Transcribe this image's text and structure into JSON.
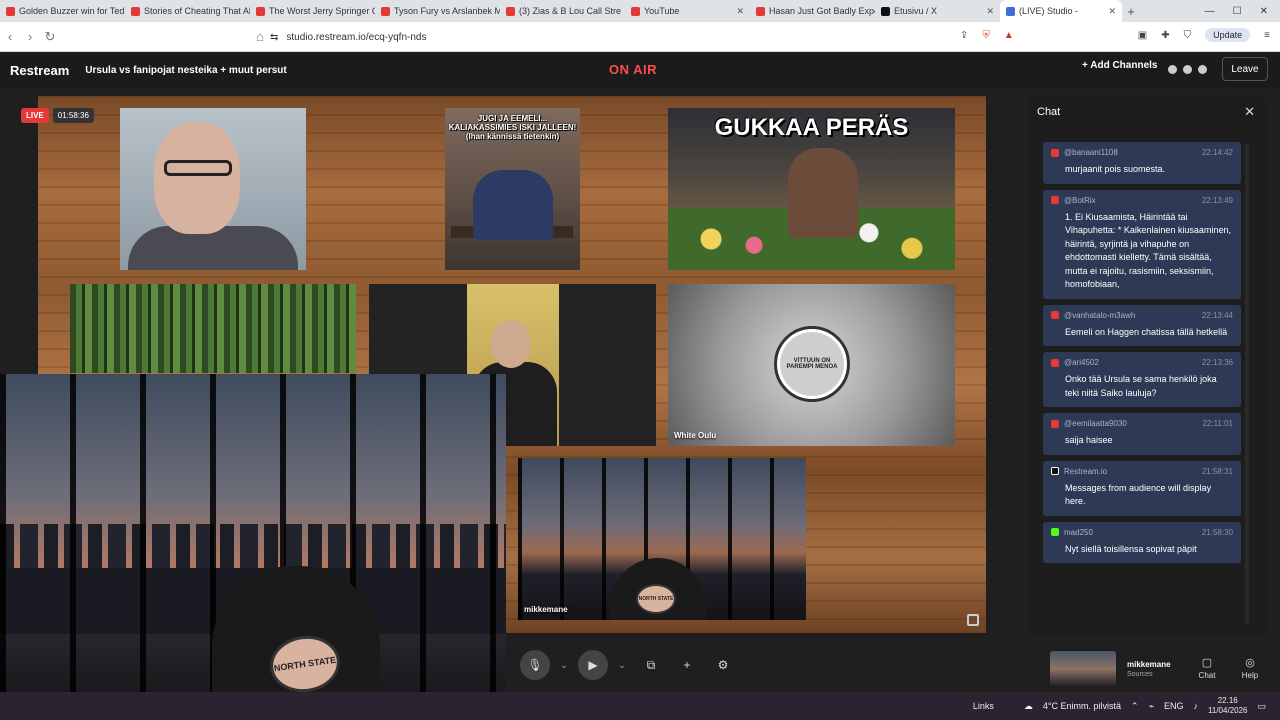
{
  "browser": {
    "tabs": [
      {
        "title": "Golden Buzzer win for Ted",
        "color": "#e53935"
      },
      {
        "title": "Stories of Cheating That Al",
        "color": "#e53935"
      },
      {
        "title": "The Worst Jerry Springer G",
        "color": "#e53935"
      },
      {
        "title": "Tyson Fury vs Arslanbek M",
        "color": "#e53935"
      },
      {
        "title": "(3) Zias & B Lou Call Stre",
        "color": "#e53935"
      },
      {
        "title": "YouTube",
        "color": "#e53935"
      },
      {
        "title": "Hasan Just Got Badly Expo",
        "color": "#e53935"
      },
      {
        "title": "Etusivu / X",
        "color": "#111111"
      },
      {
        "title": "(LIVE) Studio -",
        "color": "#3b6fd8"
      }
    ],
    "url": "studio.restream.io/ecq-yqfn-nds",
    "update_label": "Update"
  },
  "header": {
    "logo": "Restream",
    "stream_title": "Ursula vs fanipojat nesteika + muut persut",
    "on_air": "ON AIR",
    "add_channels": "+ Add Channels",
    "leave": "Leave"
  },
  "stage": {
    "live_label": "LIVE",
    "timer": "01:58:36",
    "meme1_caption": "JUGI JA EEMELI... KALIAKASSIMIES ISKI JALLEEN! (Ihan kännissä tietenkin)",
    "meme2_caption": "GUKKAA PERÄS",
    "white_oulu_label": "White Oulu",
    "white_oulu_logo_text": "VITTUUN ON PAREMPI MENOA",
    "mikke_label": "mikkemane",
    "hat_text": "NORTH STATE"
  },
  "chat": {
    "title": "Chat",
    "messages": [
      {
        "user": "@banaani1108",
        "time": "22:14:42",
        "text": "murjaanit pois suomesta.",
        "source_color": "#e53935"
      },
      {
        "user": "@BotRix",
        "time": "22:13:49",
        "text": "1. Ei Kiusaamista, Häirintää tai Vihapuhetta: * Kaikenlainen kiusaaminen, häirintä, syrjintä ja vihapuhe on ehdottomasti kielletty. Tämä sisältää, mutta ei rajoitu, rasismiin, seksismiin, homofobiaan,",
        "source_color": "#e53935"
      },
      {
        "user": "@vanhatalo-m3awh",
        "time": "22:13:44",
        "text": "Eemeli on Haggen chatissa tällä hetkellä",
        "source_color": "#e53935"
      },
      {
        "user": "@ari4502",
        "time": "22:13:36",
        "text": "Onko tää Ursula se sama henkilö joka teki niitä Saiko lauluja?",
        "source_color": "#e53935"
      },
      {
        "user": "@eemilaatta9030",
        "time": "22:11:01",
        "text": "saija haisee",
        "source_color": "#e53935"
      },
      {
        "user": "Restream.io",
        "time": "21:58:31",
        "text": "Messages from audience will display here.",
        "source_color": "#111111"
      },
      {
        "user": "mad250",
        "time": "21:58:30",
        "text": "Nyt siellä toisillensa sopivat päpit",
        "source_color": "#53fc18"
      }
    ]
  },
  "toolbar": {
    "source_name": "mikkemane",
    "source_sub": "Sources",
    "chat_label": "Chat",
    "help_label": "Help"
  },
  "taskbar": {
    "links": "Links",
    "weather": "4°C  Enimm. pilvistä",
    "lang": "ENG",
    "time": "22.16",
    "date": "11/04/2026"
  }
}
